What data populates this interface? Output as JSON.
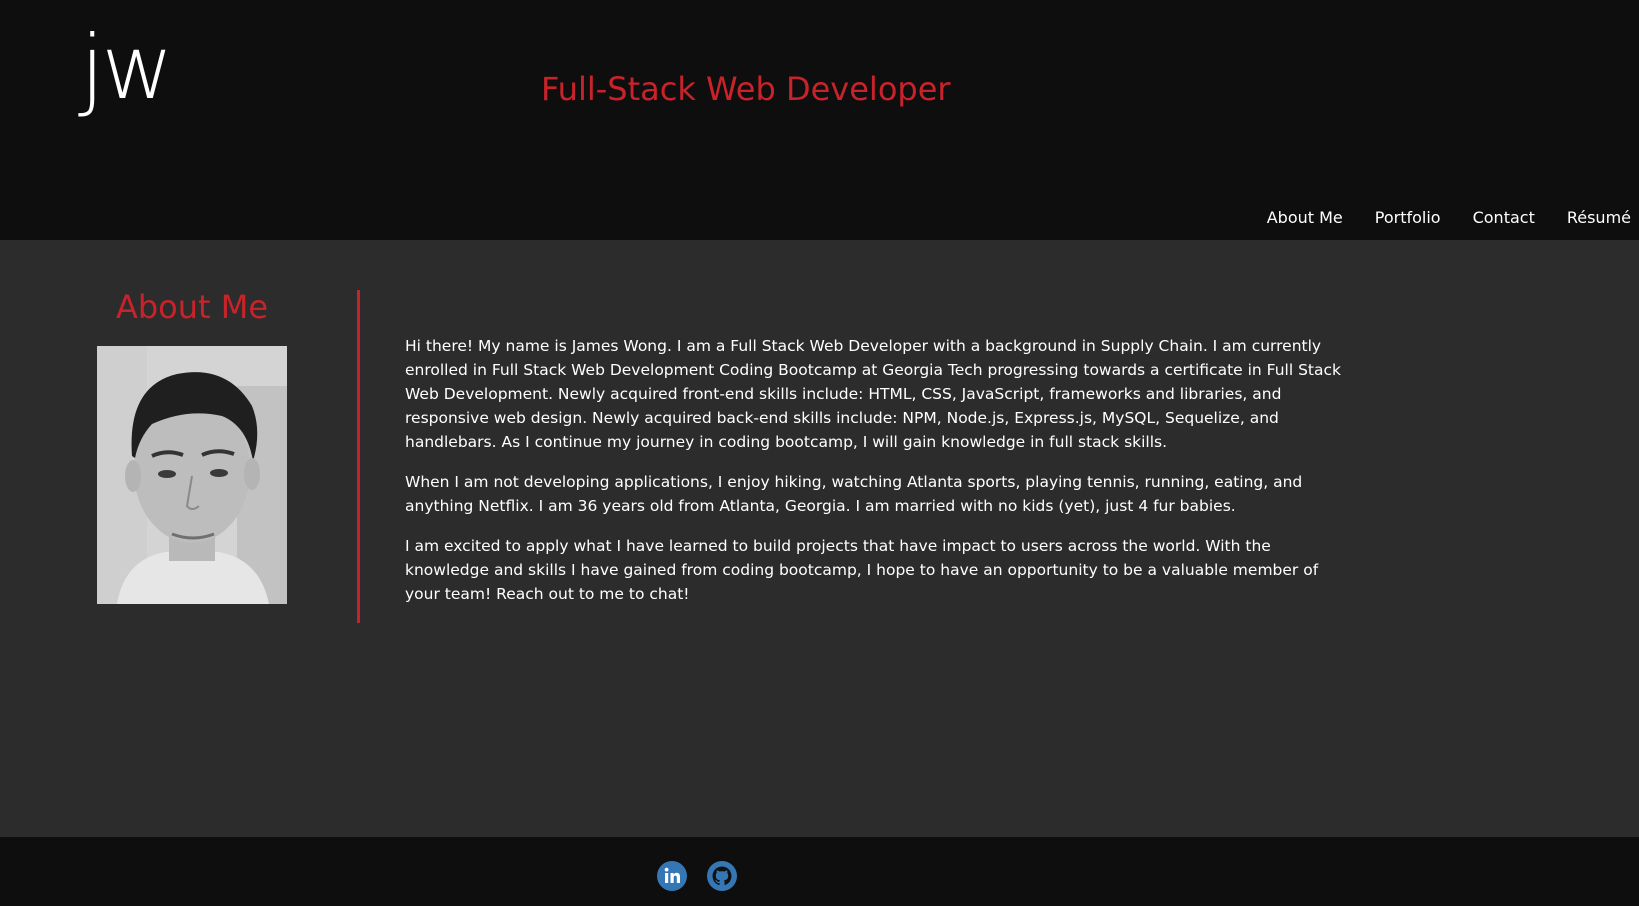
{
  "header": {
    "logo": "jw",
    "tagline": "Full-Stack Web Developer",
    "nav": [
      "About Me",
      "Portfolio",
      "Contact",
      "Résumé"
    ]
  },
  "about": {
    "title": "About Me",
    "paragraphs": [
      "Hi there! My name is James Wong. I am a Full Stack Web Developer with a background in Supply Chain. I am currently enrolled in Full Stack Web Development Coding Bootcamp at Georgia Tech progressing towards a certificate in Full Stack Web Development. Newly acquired front-end skills include: HTML, CSS, JavaScript, frameworks and libraries, and responsive web design. Newly acquired back-end skills include: NPM, Node.js, Express.js, MySQL, Sequelize, and handlebars. As I continue my journey in coding bootcamp, I will gain knowledge in full stack skills.",
      "When I am not developing applications, I enjoy hiking, watching Atlanta sports, playing tennis, running, eating, and anything Netflix. I am 36 years old from Atlanta, Georgia. I am married with no kids (yet), just 4 fur babies.",
      "I am excited to apply what I have learned to build projects that have impact to users across the world. With the knowledge and skills I have gained from coding bootcamp, I hope to have an opportunity to be a valuable member of your team! Reach out to me to chat!"
    ]
  },
  "footer": {
    "social_icons": [
      "linkedin-icon",
      "github-icon"
    ]
  },
  "colors": {
    "accent": "#c8232a",
    "header_bg": "#0e0e0e",
    "body_bg": "#2c2c2c",
    "text": "#ffffff",
    "social_icon": "#3577b5"
  }
}
